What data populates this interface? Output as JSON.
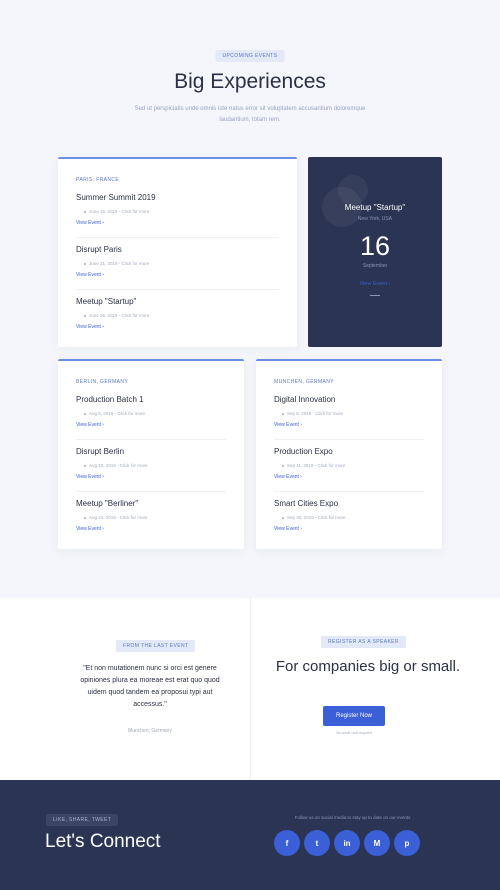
{
  "header": {
    "pill": "UPCOMING EVENTS",
    "title": "Big Experiences",
    "subtitle": "Sed ut perspiciatis unde omnis iste natus error sit voluptatem accusantium doloremque laudantium, totam rem."
  },
  "cards": [
    {
      "location": "PARIS, FRANCE",
      "events": [
        {
          "name": "Summer Summit 2019",
          "date": "June 15, 2019 - Click for more",
          "view": "View Event  ›"
        },
        {
          "name": "Disrupt Paris",
          "date": "June 21, 2019 - Click for more",
          "view": "View Event  ›"
        },
        {
          "name": "Meetup \"Startup\"",
          "date": "June 26, 2019 - Click for more",
          "view": "View Event  ›"
        }
      ]
    },
    {
      "location": "BERLIN, GERMANY",
      "events": [
        {
          "name": "Production Batch 1",
          "date": "Aug 5, 2019 - Click for more",
          "view": "View Event  ›"
        },
        {
          "name": "Disrupt Berlin",
          "date": "Aug 12, 2019 - Click for more",
          "view": "View Event  ›"
        },
        {
          "name": "Meetup \"Berliner\"",
          "date": "Aug 22, 2019 - Click for more",
          "view": "View Event  ›"
        }
      ]
    },
    {
      "location": "MUNCHEN, GERMANY",
      "events": [
        {
          "name": "Digital Innovation",
          "date": "Sep 6, 2019 - Click for more",
          "view": "View Event  ›"
        },
        {
          "name": "Production Expo",
          "date": "Sep 11, 2019 - Click for more",
          "view": "View Event  ›"
        },
        {
          "name": "Smart Cities Expo",
          "date": "Sep 30, 2019 - Click for more",
          "view": "View Event  ›"
        }
      ]
    }
  ],
  "featured": {
    "title": "Meetup \"Startup\"",
    "location": "New York, USA",
    "day": "16",
    "month": "September",
    "view": "View Event  ›"
  },
  "testimonial": {
    "pill": "FROM THE LAST EVENT",
    "quote": "\"Et non mutationem nunc si orci est genere opiniones plura ea moreae est erat quo quod uidem quod tandem ea proposui typi aut accessus.\"",
    "author": "Munchen, Germany"
  },
  "cta": {
    "pill": "REGISTER AS A SPEAKER",
    "heading": "For companies big or small.",
    "button": "Register Now",
    "note": "No credit card required"
  },
  "footer": {
    "pill": "LIKE, SHARE, TWEET",
    "title": "Let's Connect",
    "follow": "Follow us on social media to stay up to date on our events",
    "socials": [
      {
        "icon": "facebook-icon",
        "glyph": "f"
      },
      {
        "icon": "twitter-icon",
        "glyph": "t"
      },
      {
        "icon": "linkedin-icon",
        "glyph": "in"
      },
      {
        "icon": "medium-icon",
        "glyph": "M"
      },
      {
        "icon": "pinterest-icon",
        "glyph": "p"
      }
    ]
  },
  "colors": {
    "accent": "#3a5fd6",
    "dark": "#2b3452",
    "background": "#f4f6fb"
  }
}
